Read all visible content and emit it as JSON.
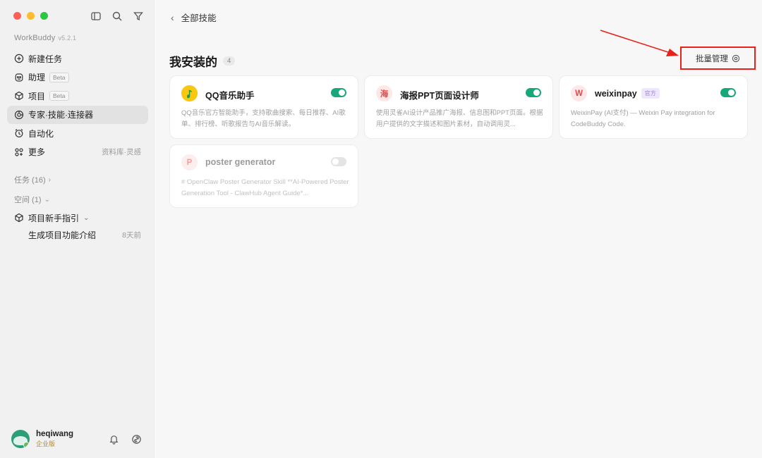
{
  "app": {
    "name": "WorkBuddy",
    "version": "v5.2.1"
  },
  "nav": {
    "items": [
      {
        "label": "新建任务",
        "icon": "plus-circle-icon",
        "badge": "",
        "right": ""
      },
      {
        "label": "助理",
        "icon": "assistant-icon",
        "badge": "Beta",
        "right": ""
      },
      {
        "label": "项目",
        "icon": "project-icon",
        "badge": "Beta",
        "right": ""
      },
      {
        "label": "专家·技能·连接器",
        "icon": "skills-icon",
        "badge": "",
        "right": ""
      },
      {
        "label": "自动化",
        "icon": "alarm-clock-icon",
        "badge": "",
        "right": ""
      },
      {
        "label": "更多",
        "icon": "grid-more-icon",
        "badge": "",
        "right": "资料库·灵感"
      }
    ],
    "active_index": 3
  },
  "sections": {
    "tasks": "任务 (16)",
    "spaces": "空间 (1)"
  },
  "project": {
    "name": "项目新手指引",
    "children": [
      {
        "label": "生成项目功能介绍",
        "time": "8天前"
      }
    ]
  },
  "user": {
    "name": "heqiwang",
    "tier": "企业版"
  },
  "main": {
    "back_label": "全部技能",
    "heading": "我安装的",
    "count": "4",
    "batch_label": "批量管理"
  },
  "skills": [
    {
      "name": "QQ音乐助手",
      "icon_text": "",
      "icon_type": "qq-music-icon",
      "tag": "",
      "enabled": true,
      "desc": "QQ音乐官方智能助手，支持歌曲搜索、每日推荐、AI歌单、排行榜、听歌报告与AI音乐解读。"
    },
    {
      "name": "海报PPT页面设计师",
      "icon_text": "海",
      "icon_type": "letter-icon",
      "tag": "",
      "enabled": true,
      "desc": "使用灵雀AI设计产品推广海报、信息图和PPT页面。根据用户提供的文字描述和图片素材，自动调用灵..."
    },
    {
      "name": "weixinpay",
      "icon_text": "W",
      "icon_type": "letter-icon",
      "tag": "官方",
      "enabled": true,
      "desc": "WeixinPay (AI支付) — Weixin Pay integration for CodeBuddy Code."
    },
    {
      "name": "poster generator",
      "icon_text": "P",
      "icon_type": "letter-icon",
      "tag": "",
      "enabled": false,
      "desc": "# OpenClaw Poster Generator Skill **AI-Powered Poster Generation Tool - ClawHub Agent Guide*..."
    }
  ],
  "colors": {
    "toggle_on": "#16a77b",
    "annotation_red": "#e8221b",
    "sidebar_bg": "#f1f1f1",
    "main_bg": "#f7f7f7"
  }
}
